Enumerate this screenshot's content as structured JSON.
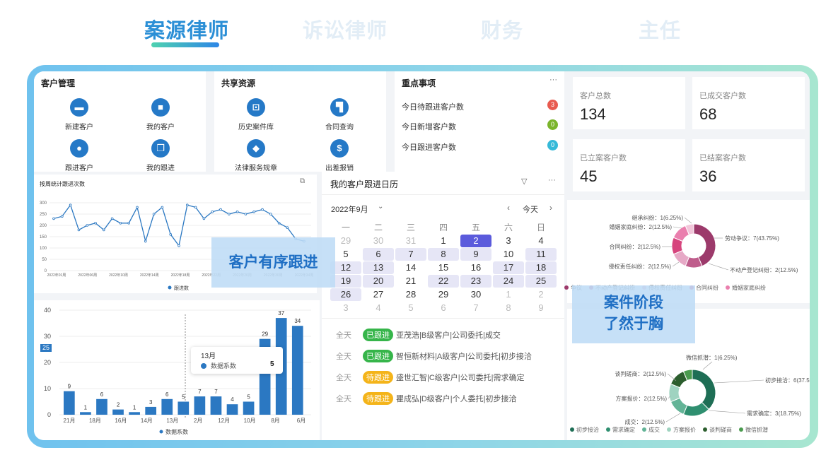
{
  "tabs": [
    {
      "label": "案源律师",
      "active": true
    },
    {
      "label": "诉讼律师",
      "active": false
    },
    {
      "label": "财务",
      "active": false
    },
    {
      "label": "主任",
      "active": false
    }
  ],
  "customer_mgmt": {
    "title": "客户管理",
    "items": [
      {
        "label": "新建客户",
        "icon": "folder-icon"
      },
      {
        "label": "我的客户",
        "icon": "briefcase-icon"
      },
      {
        "label": "跟进客户",
        "icon": "user-icon"
      },
      {
        "label": "我的跟进",
        "icon": "copy-icon"
      }
    ]
  },
  "shared": {
    "title": "共享资源",
    "items": [
      {
        "label": "历史案件库",
        "icon": "inbox-icon"
      },
      {
        "label": "合同查询",
        "icon": "paint-roller-icon"
      },
      {
        "label": "法律服务规章",
        "icon": "book-icon"
      },
      {
        "label": "出差报销",
        "icon": "dollar-icon"
      }
    ]
  },
  "key_items": {
    "title": "重点事项",
    "more": "···",
    "rows": [
      {
        "label": "今日待跟进客户数",
        "value": "3",
        "color": "#e85a4f"
      },
      {
        "label": "今日新增客户数",
        "value": "0",
        "color": "#7bb52c"
      },
      {
        "label": "今日跟进客户数",
        "value": "0",
        "color": "#36b9d8"
      }
    ]
  },
  "stats": [
    {
      "label": "客户总数",
      "value": "134"
    },
    {
      "label": "已成交客户数",
      "value": "68"
    },
    {
      "label": "已立案客户数",
      "value": "45"
    },
    {
      "label": "已结案客户数",
      "value": "36"
    }
  ],
  "line_chart": {
    "title": "按周统计跟进次数",
    "legend": "跟进数",
    "icons": [
      "⧉",
      "···"
    ]
  },
  "bar_chart": {
    "legend": "数据系数",
    "tooltip": {
      "title": "13月",
      "series": "数据系数",
      "value": "5"
    }
  },
  "overlays": {
    "follow": "客户有序跟进",
    "stage_line1": "案件阶段",
    "stage_line2": "了然于胸"
  },
  "calendar": {
    "title": "我的客户跟进日历",
    "month": "2022年9月",
    "today": "今天",
    "weekdays": [
      "一",
      "二",
      "三",
      "四",
      "五",
      "六",
      "日"
    ],
    "days": [
      "29",
      "30",
      "31",
      "1",
      "2",
      "3",
      "4",
      "5",
      "6",
      "7",
      "8",
      "9",
      "10",
      "11",
      "12",
      "13",
      "14",
      "15",
      "16",
      "17",
      "18",
      "19",
      "20",
      "21",
      "22",
      "23",
      "24",
      "25",
      "26",
      "27",
      "28",
      "29",
      "30",
      "1",
      "2",
      "3",
      "4",
      "5",
      "6",
      "7",
      "8",
      "9"
    ],
    "events": [
      {
        "time": "全天",
        "tag": "已跟进",
        "color": "#36b54a",
        "text": "亚茂浩|B级客户|公司委托|成交"
      },
      {
        "time": "全天",
        "tag": "已跟进",
        "color": "#36b54a",
        "text": "智恒新材料|A级客户|公司委托|初步接洽"
      },
      {
        "time": "全天",
        "tag": "待跟进",
        "color": "#f4b41a",
        "text": "盛世汇智|C级客户|公司委托|需求确定"
      },
      {
        "time": "全天",
        "tag": "待跟进",
        "color": "#f4b41a",
        "text": "瞿成弘|D级客户|个人委托|初步接洽"
      }
    ]
  },
  "pie1_legend": [
    "争议",
    "不动产登记纠纷",
    "侵权责任纠纷",
    "合同纠纷",
    "婚姻家庭纠纷"
  ],
  "pie2_legend": [
    "初步接洽",
    "需求确定",
    "成交",
    "方案报价",
    "谈判磋商",
    "微信抓潜"
  ],
  "chart_data": [
    {
      "type": "line",
      "title": "按周统计跟进次数",
      "series": [
        {
          "name": "跟进数",
          "values": [
            230,
            240,
            290,
            180,
            200,
            210,
            180,
            230,
            210,
            210,
            280,
            130,
            250,
            280,
            160,
            110,
            290,
            280,
            230,
            260,
            270,
            250,
            260,
            250,
            260,
            270,
            250,
            210,
            190,
            140,
            130
          ]
        }
      ],
      "x_ticks": [
        "2022年01周",
        "2022年06周",
        "2022年10周",
        "2022年14周",
        "2022年18周",
        "2022年22周",
        "2022年26周",
        "2022年30周",
        "2022年34周"
      ],
      "y_ticks": [
        0,
        50,
        100,
        150,
        200,
        250,
        300
      ],
      "ylim": [
        0,
        300
      ]
    },
    {
      "type": "bar",
      "series": [
        {
          "name": "数据系数",
          "values": [
            9,
            1,
            6,
            2,
            1,
            3,
            6,
            5,
            7,
            7,
            4,
            5,
            29,
            37,
            34
          ]
        }
      ],
      "x_ticks": [
        "21月",
        "18月",
        "16月",
        "14月",
        "13月",
        "2月",
        "12月",
        "10月",
        "8月",
        "6月"
      ],
      "y_ticks": [
        0,
        10,
        20,
        30,
        40
      ],
      "ylim": [
        0,
        40
      ],
      "highlight_label": "25"
    },
    {
      "type": "pie",
      "slices": [
        {
          "label": "劳动争议",
          "value": 7,
          "pct": "43.75%",
          "color": "#9c3a6b"
        },
        {
          "label": "不动产登记纠纷",
          "value": 2,
          "pct": "12.5%",
          "color": "#bf5d8c"
        },
        {
          "label": "侵权责任纠纷",
          "value": 2,
          "pct": "12.5%",
          "color": "#e6a9c6"
        },
        {
          "label": "合同纠纷",
          "value": 2,
          "pct": "12.5%",
          "color": "#d6447d"
        },
        {
          "label": "婚姻家庭纠纷",
          "value": 2,
          "pct": "12.5%",
          "color": "#ea7fae"
        },
        {
          "label": "继承纠纷",
          "value": 1,
          "pct": "6.25%",
          "color": "#f2c6da"
        }
      ]
    },
    {
      "type": "pie",
      "slices": [
        {
          "label": "初步接洽",
          "value": 6,
          "pct": "37.5%",
          "color": "#1e6e55"
        },
        {
          "label": "需求确定",
          "value": 3,
          "pct": "18.75%",
          "color": "#2f8f70"
        },
        {
          "label": "成交",
          "value": 2,
          "pct": "12.5%",
          "color": "#63b497"
        },
        {
          "label": "方案报价",
          "value": 2,
          "pct": "12.5%",
          "color": "#9fd3c0"
        },
        {
          "label": "谈判磋商",
          "value": 2,
          "pct": "12.5%",
          "color": "#2c5e2e"
        },
        {
          "label": "微信抓潜",
          "value": 1,
          "pct": "6.25%",
          "color": "#4a9b4e"
        }
      ]
    }
  ]
}
